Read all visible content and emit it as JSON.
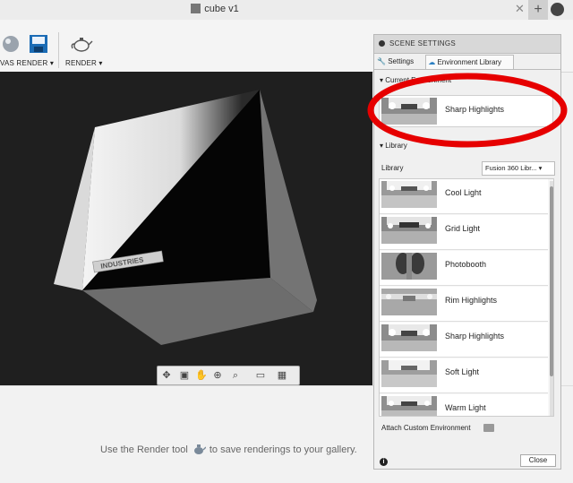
{
  "window": {
    "title": "cube v1"
  },
  "toolbar": {
    "canvas_render_label": "VAS RENDER ▾",
    "render_label": "RENDER ▾"
  },
  "status": {
    "message_before": "Use the Render tool",
    "message_after": "to save renderings to your gallery."
  },
  "scene_settings": {
    "title": "SCENE SETTINGS",
    "tabs": [
      {
        "label": "Settings"
      },
      {
        "label": "Environment Library"
      }
    ],
    "current_section": "Current Environment",
    "current": {
      "label": "Sharp Highlights"
    },
    "library_section": "Library",
    "library_label": "Library",
    "library_select": "Fusion 360 Libr... ▾",
    "items": [
      {
        "label": "Cool Light"
      },
      {
        "label": "Grid Light"
      },
      {
        "label": "Photobooth"
      },
      {
        "label": "Rim Highlights"
      },
      {
        "label": "Sharp Highlights"
      },
      {
        "label": "Soft Light"
      },
      {
        "label": "Warm Light"
      }
    ],
    "attach_label": "Attach Custom Environment",
    "close_label": "Close"
  },
  "viewport": {
    "logo_text": "INDUSTRIES"
  },
  "colors": {
    "annotation": "#e60000",
    "viewport_bg": "#1f1f1f"
  }
}
